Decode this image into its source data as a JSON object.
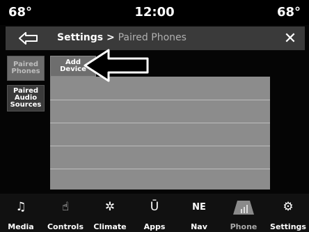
{
  "status": {
    "temp_left": "68°",
    "clock": "12:00",
    "temp_right": "68°"
  },
  "header": {
    "back_icon": "back-arrow-icon",
    "crumb_root": "Settings",
    "crumb_sep": " > ",
    "crumb_current": "Paired Phones",
    "close_label": "✕"
  },
  "sidebar": {
    "items": [
      {
        "label_line1": "Paired",
        "label_line2": "Phones",
        "selected": true
      },
      {
        "label_line1": "Paired",
        "label_line2": "Audio",
        "label_line3": "Sources",
        "selected": false
      }
    ]
  },
  "main": {
    "add_device_line1": "Add",
    "add_device_line2": "Device"
  },
  "dock": {
    "items": [
      {
        "label": "Media",
        "icon": "music-note-icon"
      },
      {
        "label": "Controls",
        "icon": "hand-icon"
      },
      {
        "label": "Climate",
        "icon": "fan-icon"
      },
      {
        "label": "Apps",
        "icon": "apps-u-icon"
      },
      {
        "label": "Nav",
        "icon": "compass-ne-icon",
        "icon_text": "NE"
      },
      {
        "label": "Phone",
        "icon": "signal-bars-icon",
        "active": true
      },
      {
        "label": "Settings",
        "icon": "gear-icon"
      }
    ]
  },
  "colors": {
    "list_bg": "#8c8c8c",
    "header_bg": "#3a3a3a",
    "selected_side": "#6b6b6b"
  }
}
